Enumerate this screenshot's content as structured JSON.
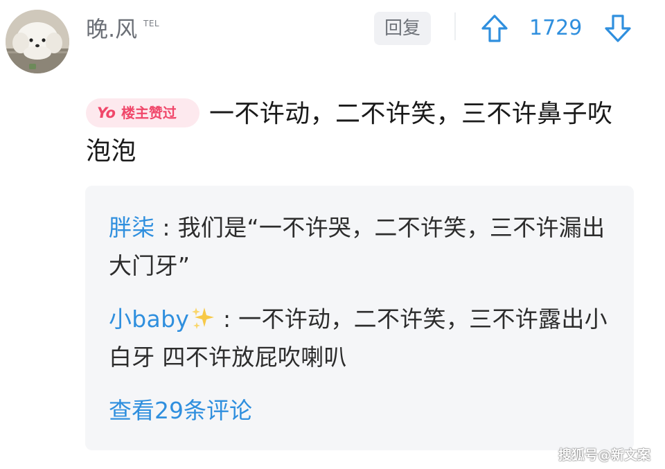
{
  "header": {
    "username": "晚.风",
    "badge": "TEL",
    "reply_label": "回复",
    "vote_count": "1729"
  },
  "comment": {
    "liked_badge_prefix": "Yo",
    "liked_badge_label": "楼主赞过",
    "text": "一不许动，二不许笑，三不许鼻子吹泡泡"
  },
  "replies": [
    {
      "author": "胖柒",
      "separator": " : ",
      "text": "我们是“一不许哭，二不许笑，三不许漏出大门牙”"
    },
    {
      "author": "小baby",
      "separator": " : ",
      "text": "一不许动，二不许笑，三不许露出小白牙 四不许放屁吹喇叭"
    }
  ],
  "view_more_label": "查看29条评论",
  "watermark": "搜狐号@新文案",
  "colors": {
    "accent_blue": "#2f8fde",
    "badge_pink": "#f0476a",
    "badge_bg": "#fde9ee",
    "reply_bg": "#f5f6f8"
  },
  "icons": {
    "upvote": "arrow-up-icon",
    "downvote": "arrow-down-icon",
    "emoji": "sparkles-icon"
  }
}
